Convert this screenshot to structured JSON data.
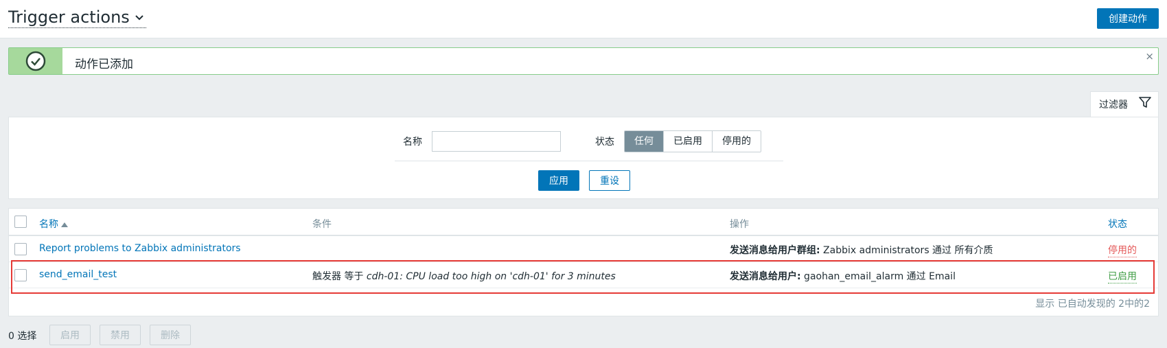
{
  "header": {
    "title": "Trigger actions",
    "create_label": "创建动作"
  },
  "message": {
    "text": "动作已添加",
    "close": "×"
  },
  "filter": {
    "tab_label": "过滤器",
    "name_label": "名称",
    "name_value": "",
    "status_label": "状态",
    "status_options": [
      "任何",
      "已启用",
      "停用的"
    ],
    "status_selected": "任何",
    "apply_label": "应用",
    "reset_label": "重设"
  },
  "table": {
    "headers": {
      "name": "名称",
      "conditions": "条件",
      "operations": "操作",
      "status": "状态"
    },
    "rows": [
      {
        "name": "Report problems to Zabbix administrators",
        "condition_prefix": "",
        "condition_value": "",
        "operation_bold": "发送消息给用户群组:",
        "operation_rest": " Zabbix administrators 通过 所有介质",
        "status": "停用的"
      },
      {
        "name": "send_email_test",
        "condition_prefix": "触发器 等于 ",
        "condition_value": "cdh-01: CPU load too high on 'cdh-01' for 3 minutes",
        "operation_bold": "发送消息给用户:",
        "operation_rest": " gaohan_email_alarm 通过 Email",
        "status": "已启用"
      }
    ],
    "footer": "显示 已自动发现的 2中的2"
  },
  "mass_actions": {
    "selected": "0 选择",
    "enable_label": "启用",
    "disable_label": "禁用",
    "delete_label": "删除"
  },
  "colors": {
    "accent": "#0275b8",
    "success_bg": "#a6d99c",
    "enabled": "#429e47",
    "disabled": "#e45959",
    "highlight": "#e53935"
  }
}
